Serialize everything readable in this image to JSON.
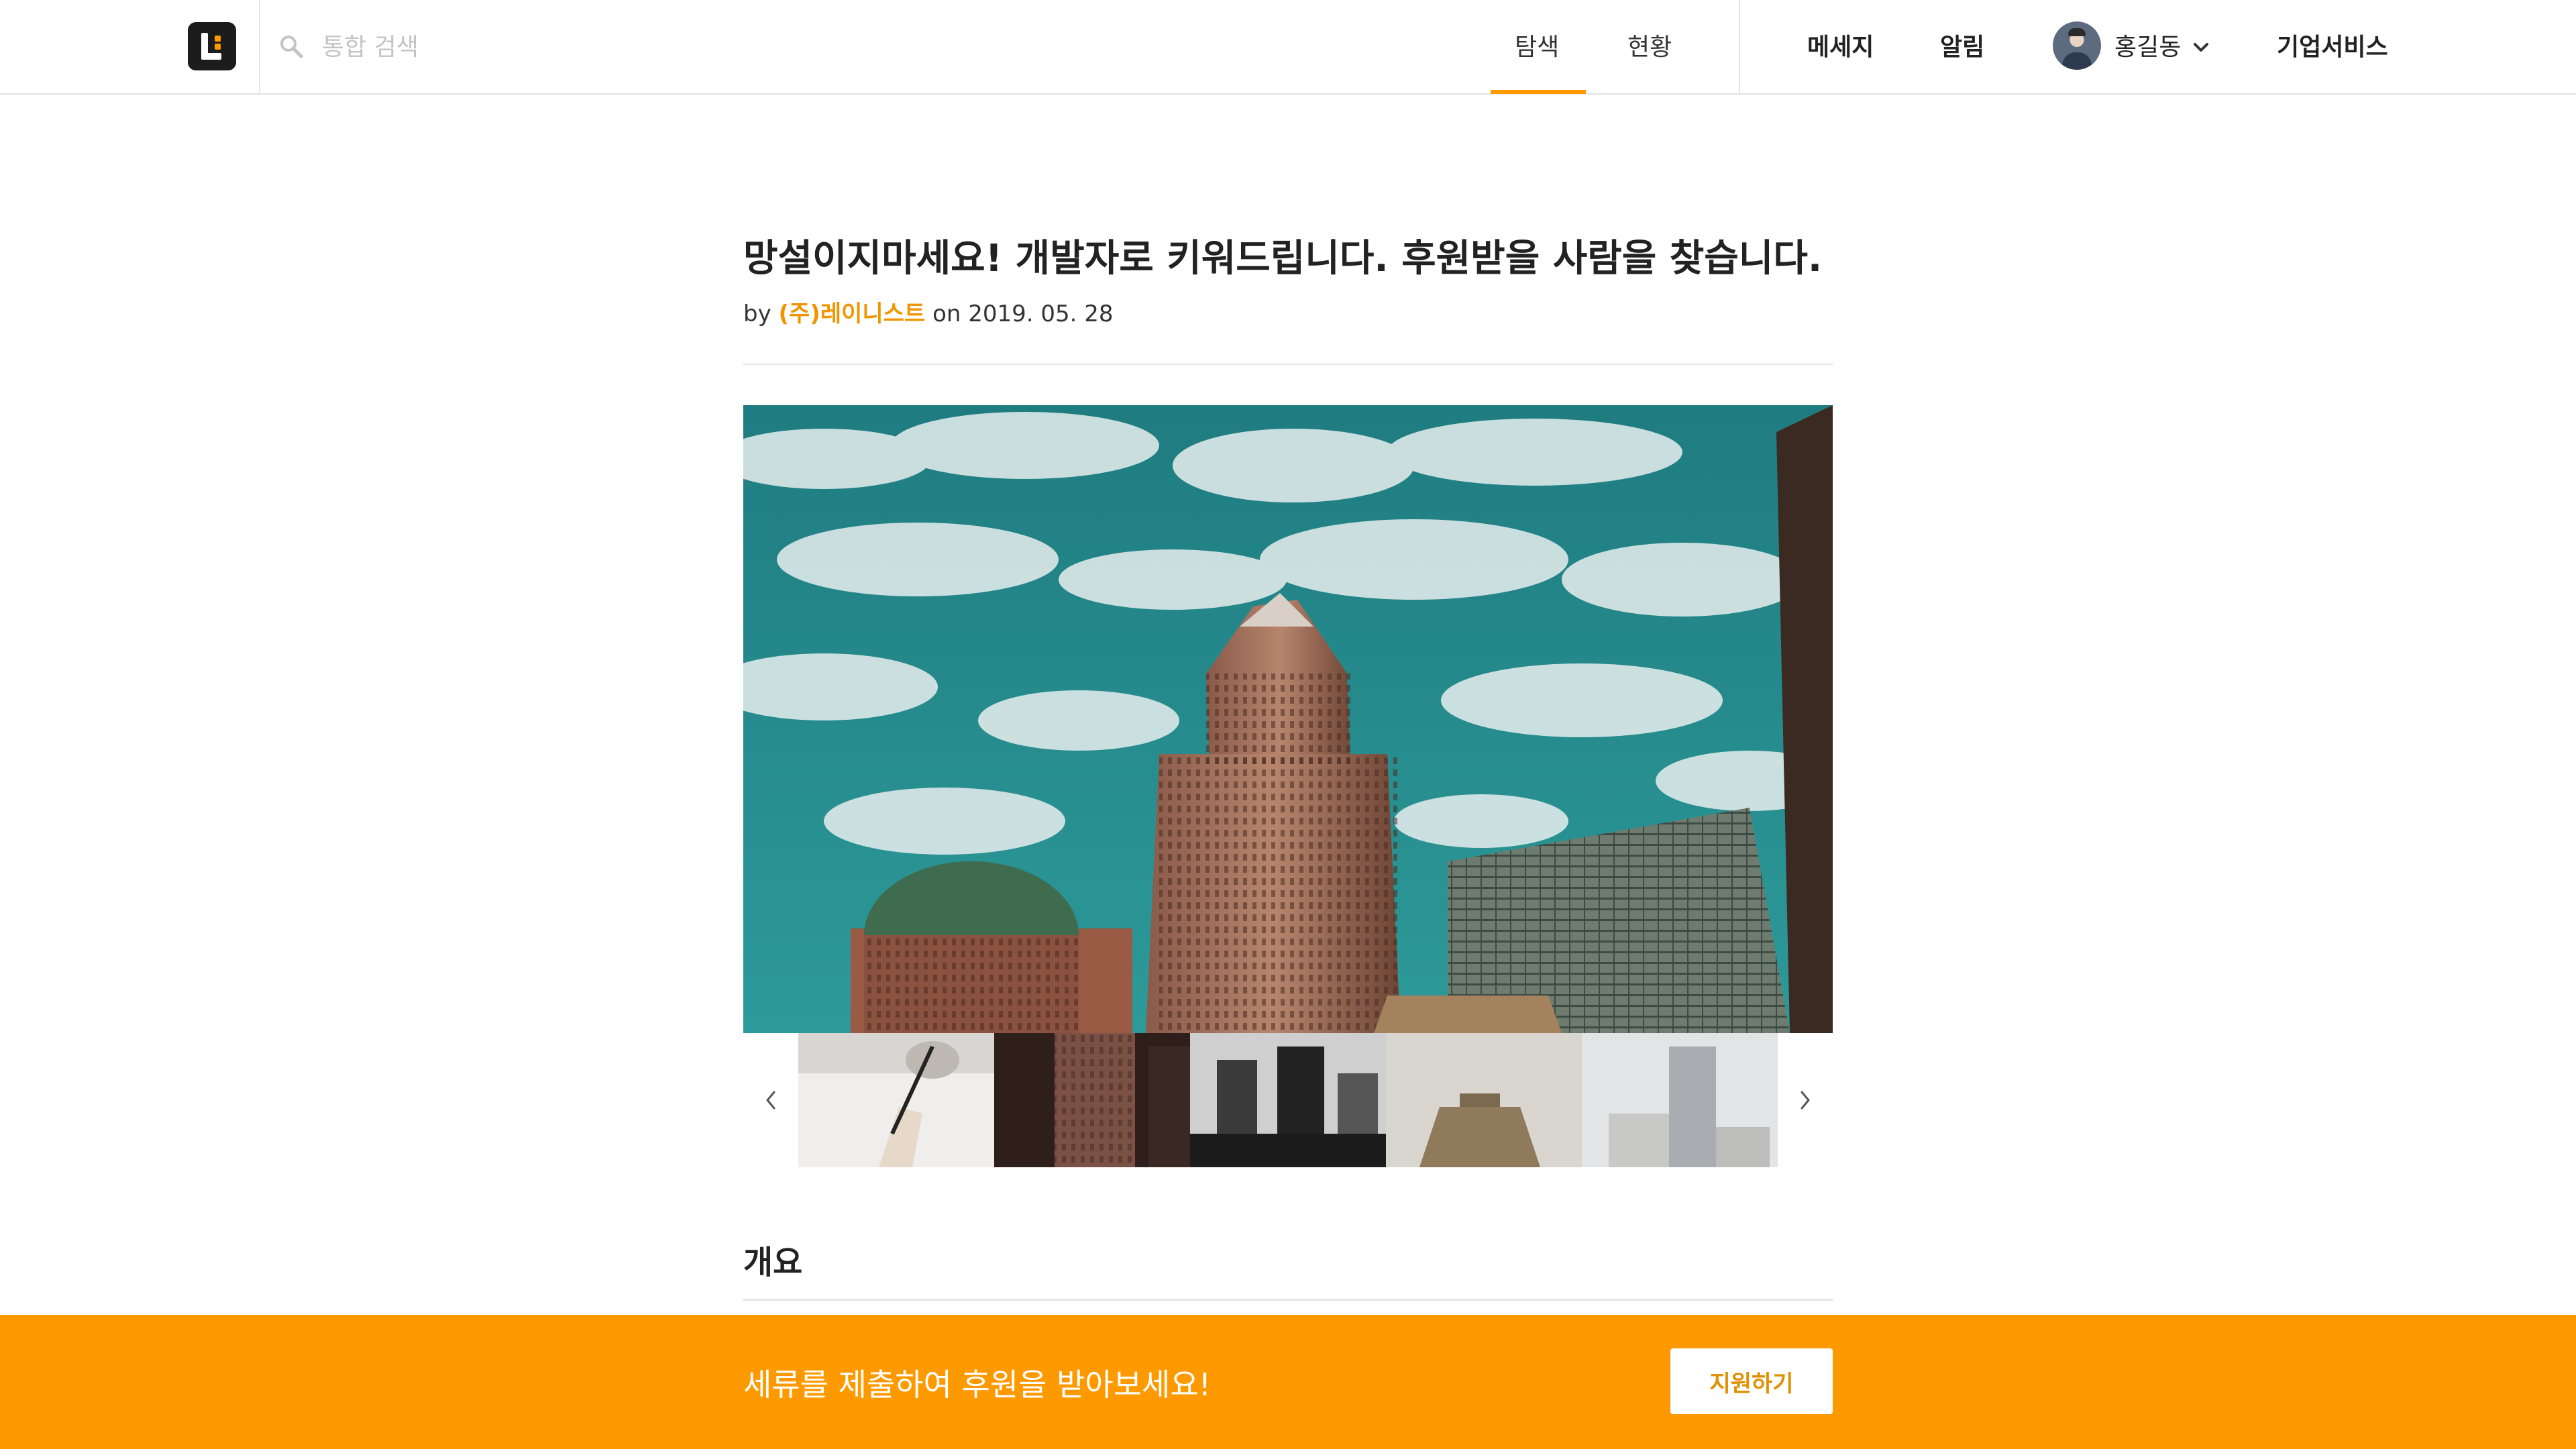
{
  "header": {
    "search": {
      "placeholder": "통합 검색",
      "value": ""
    },
    "tabs": [
      {
        "label": "탐색",
        "active": true
      },
      {
        "label": "현황",
        "active": false
      }
    ],
    "right": {
      "messages_label": "메세지",
      "notifications_label": "알림",
      "user_name": "홍길동",
      "business_label": "기업서비스"
    },
    "accent_color": "#ff9a00"
  },
  "post": {
    "title": "망설이지마세요! 개발자로 키워드립니다. 후원받을 사람을 찾습니다.",
    "by_prefix": "by",
    "company": "(주)레이니스트",
    "date_prefix": "on",
    "date": "2019. 05. 28"
  },
  "gallery": {
    "hero_image": "skyscraper-under-cloudy-sky",
    "thumbnails": [
      "hand-writing-with-pen",
      "brown-brick-buildings",
      "black-and-white-city-towers",
      "pale-stepped-building",
      "white-high-rise-tower"
    ]
  },
  "section": {
    "title": "개요"
  },
  "cta": {
    "text": "세류를 제출하여 후원을 받아보세요!",
    "button_label": "지원하기",
    "bar_color": "#ff9900"
  }
}
